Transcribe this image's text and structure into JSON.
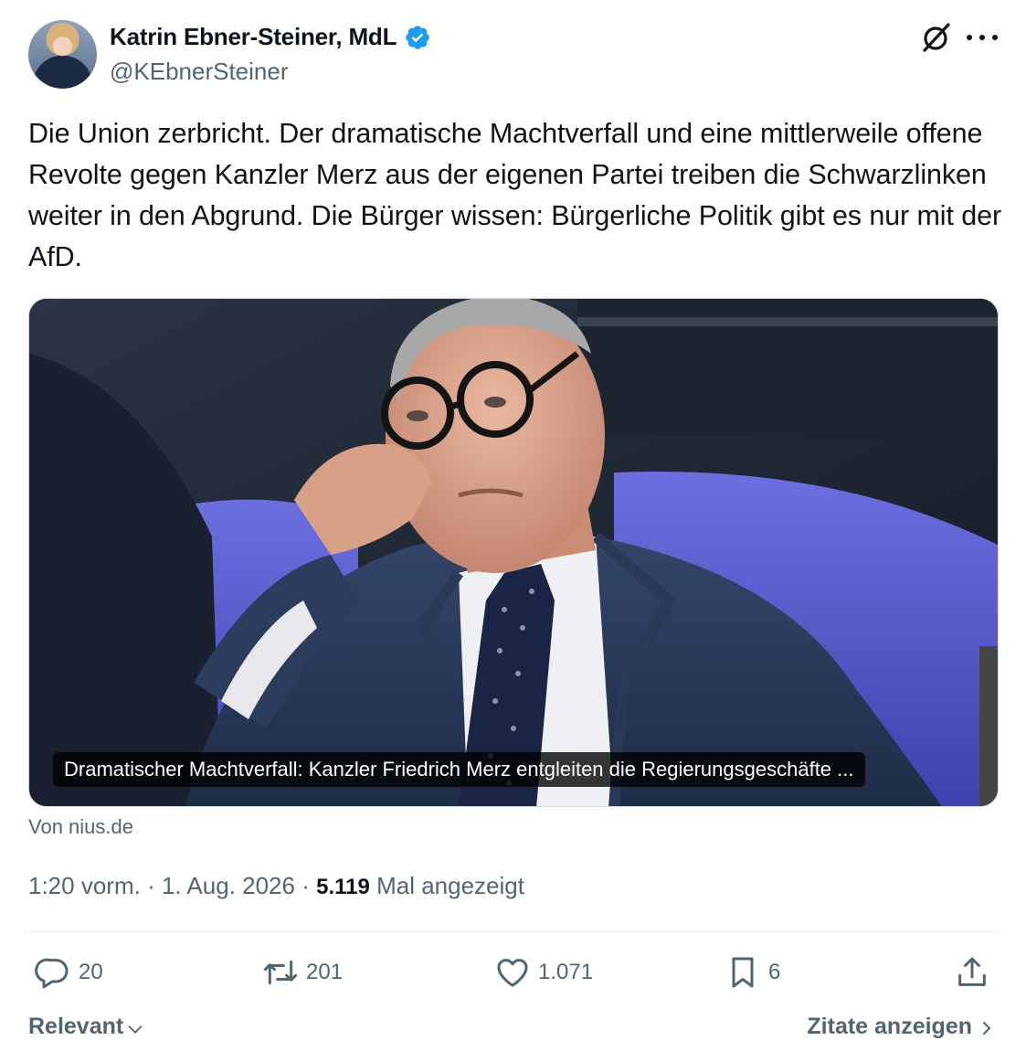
{
  "author": {
    "display_name": "Katrin Ebner-Steiner, MdL",
    "handle": "@KEbnerSteiner",
    "verified": true,
    "verified_color": "#1d9bf0"
  },
  "icons": {
    "grok": "grok-icon",
    "more": "more-icon",
    "reply": "reply-icon",
    "retweet": "retweet-icon",
    "like": "heart-icon",
    "bookmark": "bookmark-icon",
    "share": "share-icon"
  },
  "tweet": {
    "text": "Die Union zerbricht. Der dramatische Machtverfall und eine mittlerweile offene Revolte gegen Kanzler Merz aus der eigenen Partei treiben die Schwarzlinken weiter in den Abgrund. Die Bürger wissen: Bürgerliche Politik gibt es nur mit der AfD."
  },
  "card": {
    "caption": "Dramatischer Machtverfall: Kanzler Friedrich Merz entgleiten die Regierungsgeschäfte ...",
    "source": "Von nius.de"
  },
  "meta": {
    "time": "1:20 vorm.",
    "date": "1. Aug. 2026",
    "views": "5.119",
    "views_label": "Mal angezeigt"
  },
  "actions": {
    "replies": "20",
    "retweets": "201",
    "likes": "1.071",
    "bookmarks": "6"
  },
  "footer": {
    "sort_label": "Relevant",
    "quotes_label": "Zitate anzeigen"
  }
}
